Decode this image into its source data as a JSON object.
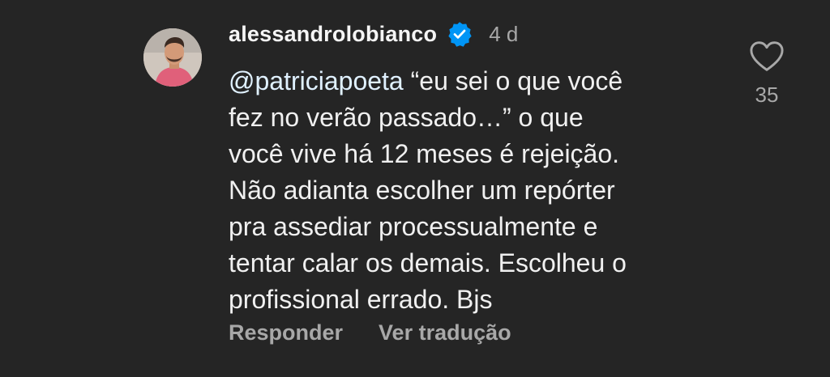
{
  "comment": {
    "username": "alessandrolobianco",
    "verified": true,
    "time": "4 d",
    "mention": "@patriciapoeta",
    "lines": [
      " “eu sei o que você",
      "fez no verão passado…” o que",
      "você vive há 12 meses é rejeição.",
      "Não adianta escolher um repórter",
      "pra assediar processualmente e",
      "tentar calar os demais. Escolheu o",
      "profissional errado. Bjs"
    ],
    "actions": {
      "reply": "Responder",
      "translate": "Ver tradução"
    },
    "likes": "35"
  },
  "colors": {
    "background": "#252525",
    "text": "#f0f0f0",
    "muted": "#a8a8a8",
    "mention": "#e0f1ff",
    "verified": "#0095f6"
  },
  "icons": {
    "verified": "verified-badge-icon",
    "like": "heart-outline-icon"
  }
}
